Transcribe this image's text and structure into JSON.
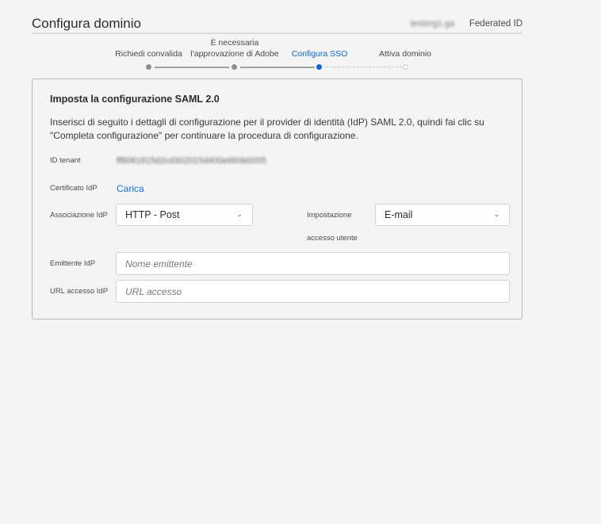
{
  "header": {
    "title": "Configura dominio",
    "org": "testorg1.ga",
    "id_type": "Federated ID"
  },
  "steps": [
    {
      "label": "Richiedi convalida",
      "state": "done"
    },
    {
      "label_line1": "È necessaria",
      "label_line2": "l'approvazione di Adobe",
      "state": "done"
    },
    {
      "label": "Configura SSO",
      "state": "current"
    },
    {
      "label": "Attiva dominio",
      "state": "pending"
    }
  ],
  "colors": {
    "accent": "#1473e6",
    "current_step": "#0d66d0"
  },
  "card": {
    "title": "Imposta la configurazione SAML 2.0",
    "description": "Inserisci di seguito i dettagli di configurazione per il provider di identità (IdP) SAML 2.0, quindi fai clic su \"Completa configurazione\" per continuare la procedura di configurazione.",
    "tenant_label": "ID tenant",
    "tenant_value": "ff8081815d2cd302015d400e660b0005",
    "cert_label": "Certificato IdP",
    "cert_link": "Carica",
    "binding_label": "Associazione IdP",
    "binding_value": "HTTP - Post",
    "login_label_1": "Impostazione",
    "login_label_2": "accesso utente",
    "login_value": "E-mail",
    "issuer_label": "Emittente IdP",
    "issuer_placeholder": "Nome emittente",
    "url_label": "URL accesso IdP",
    "url_placeholder": "URL accesso"
  }
}
